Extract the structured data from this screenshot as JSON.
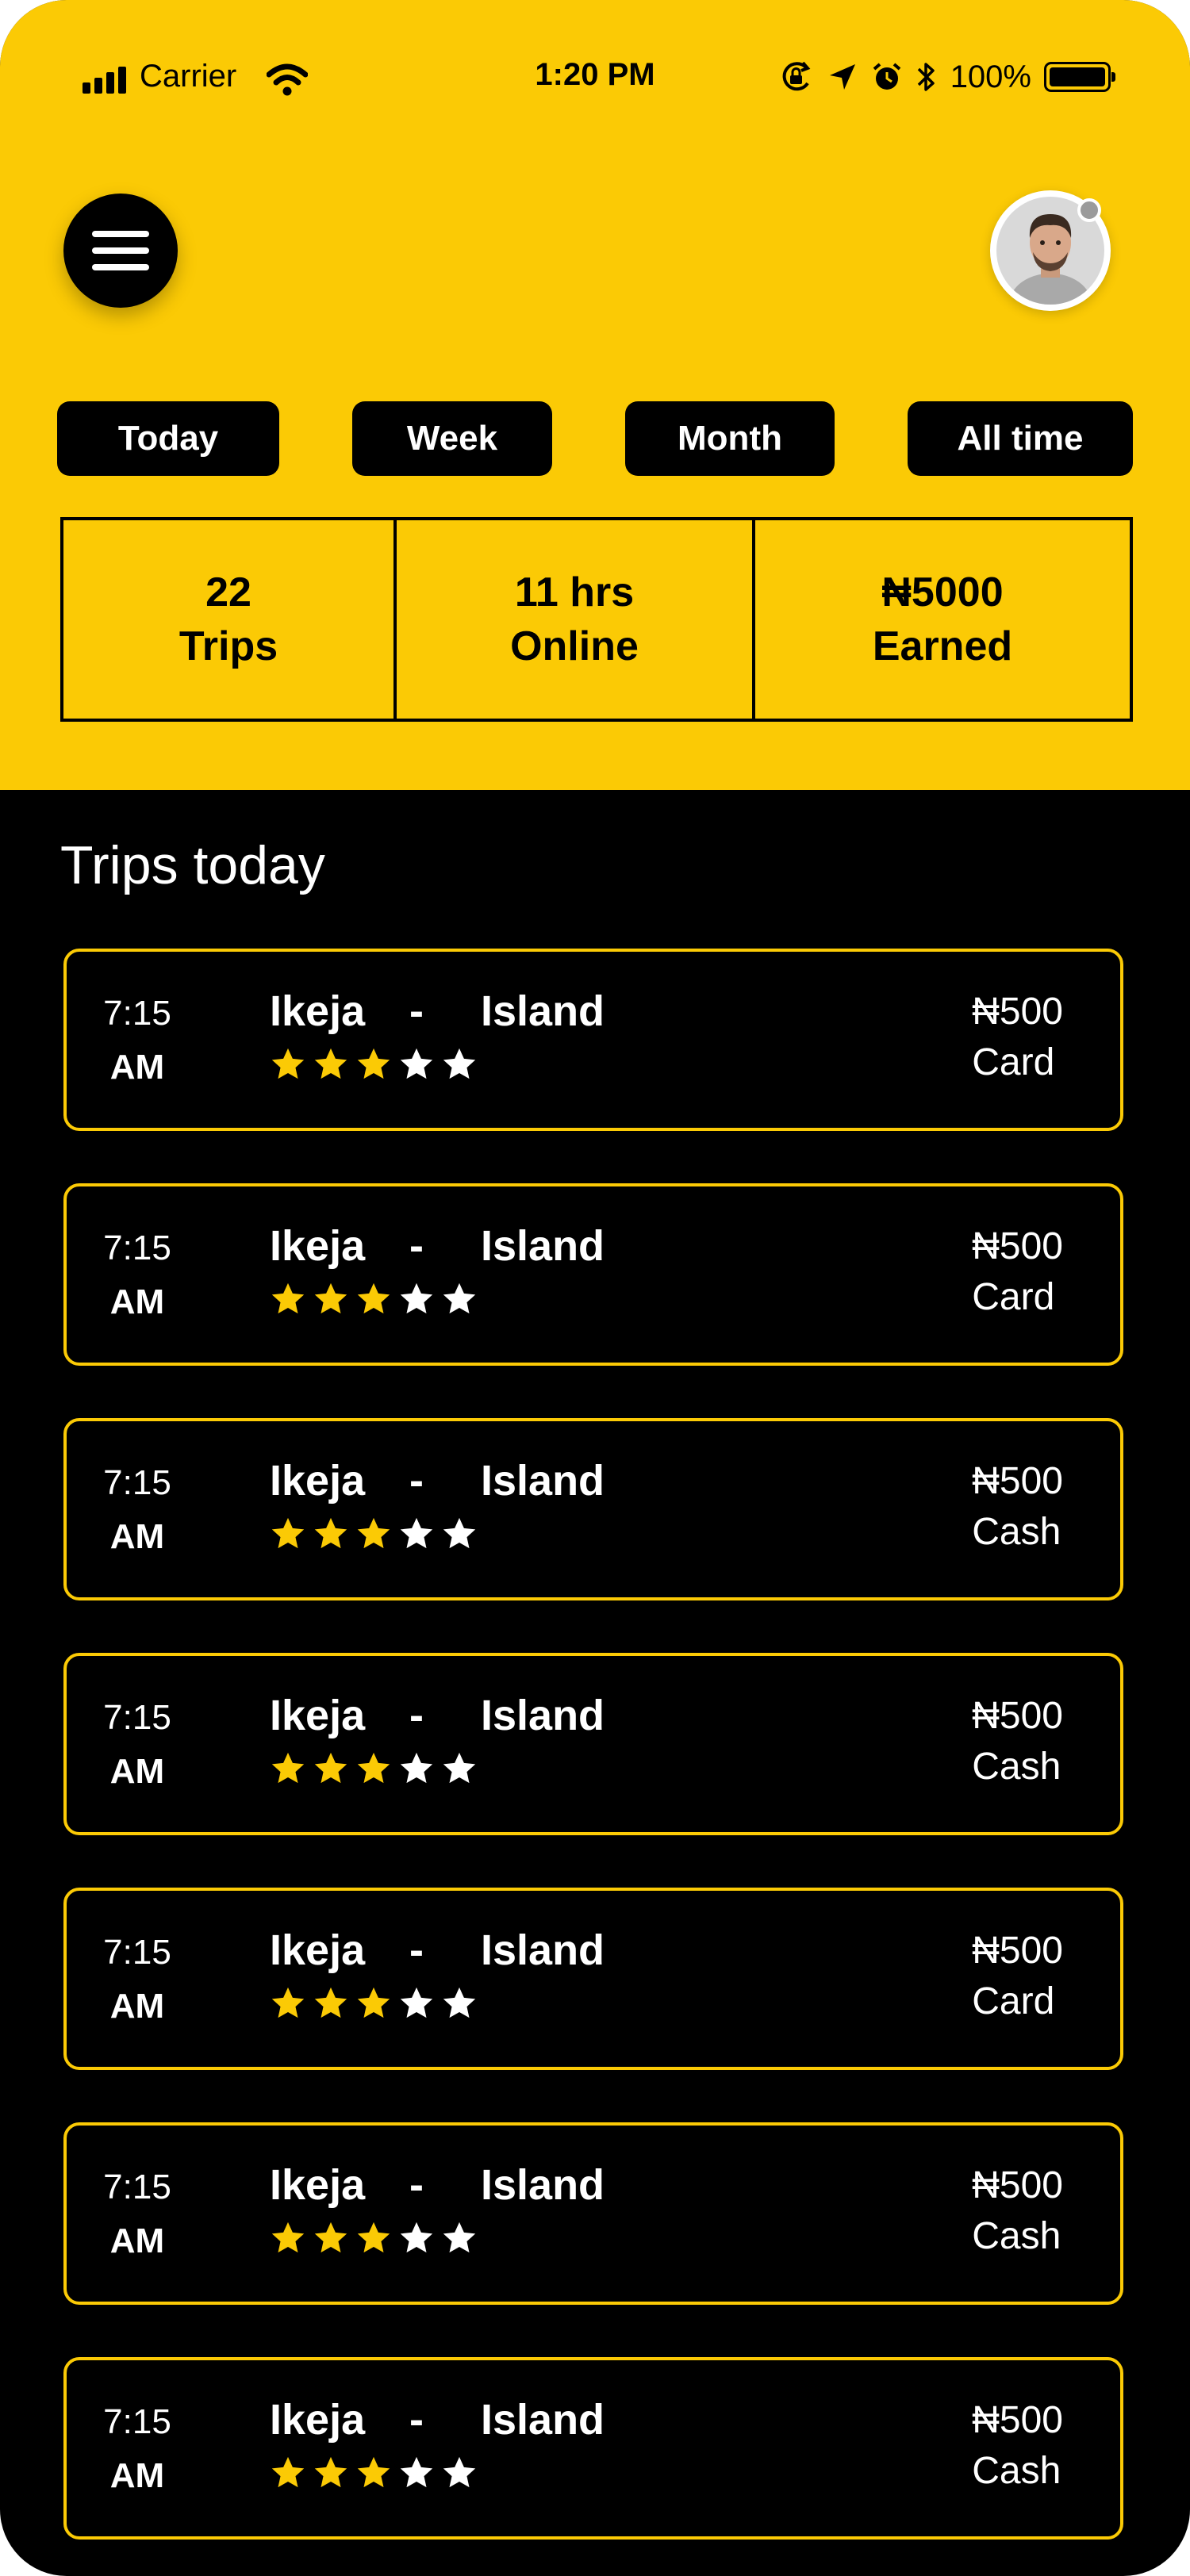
{
  "status_bar": {
    "carrier": "Carrier",
    "time": "1:20 PM",
    "battery": "100%"
  },
  "tabs": [
    "Today",
    "Week",
    "Month",
    "All time"
  ],
  "stats": [
    {
      "value": "22",
      "label": "Trips"
    },
    {
      "value": "11 hrs",
      "label": "Online"
    },
    {
      "value": "₦5000",
      "label": "Earned"
    }
  ],
  "trips_section": {
    "title": "Trips today"
  },
  "trips": [
    {
      "time": "7:15",
      "ampm": "AM",
      "from": "Ikeja",
      "separator": "-",
      "to": "Island",
      "rating": 3,
      "amount": "₦500",
      "method": "Card"
    },
    {
      "time": "7:15",
      "ampm": "AM",
      "from": "Ikeja",
      "separator": "-",
      "to": "Island",
      "rating": 3,
      "amount": "₦500",
      "method": "Card"
    },
    {
      "time": "7:15",
      "ampm": "AM",
      "from": "Ikeja",
      "separator": "-",
      "to": "Island",
      "rating": 3,
      "amount": "₦500",
      "method": "Cash"
    },
    {
      "time": "7:15",
      "ampm": "AM",
      "from": "Ikeja",
      "separator": "-",
      "to": "Island",
      "rating": 3,
      "amount": "₦500",
      "method": "Cash"
    },
    {
      "time": "7:15",
      "ampm": "AM",
      "from": "Ikeja",
      "separator": "-",
      "to": "Island",
      "rating": 3,
      "amount": "₦500",
      "method": "Card"
    },
    {
      "time": "7:15",
      "ampm": "AM",
      "from": "Ikeja",
      "separator": "-",
      "to": "Island",
      "rating": 3,
      "amount": "₦500",
      "method": "Cash"
    },
    {
      "time": "7:15",
      "ampm": "AM",
      "from": "Ikeja",
      "separator": "-",
      "to": "Island",
      "rating": 3,
      "amount": "₦500",
      "method": "Cash"
    }
  ],
  "colors": {
    "accent": "#fbca05",
    "background": "#000000",
    "star_empty": "#ffffff"
  },
  "icons": [
    "signal-icon",
    "wifi-icon",
    "orientation-lock-icon",
    "location-icon",
    "alarm-icon",
    "bluetooth-icon",
    "battery-icon",
    "menu-icon",
    "star-icon"
  ]
}
